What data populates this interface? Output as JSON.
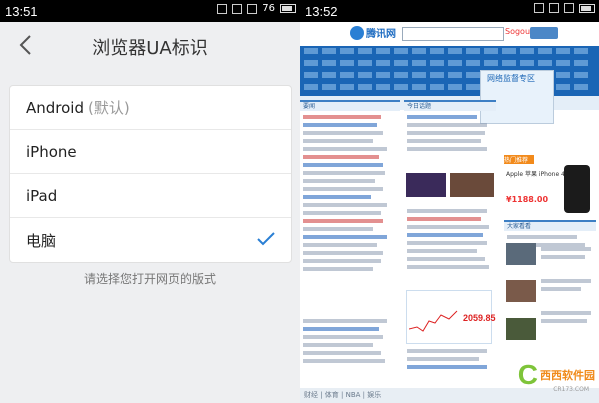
{
  "left": {
    "status": {
      "time": "13:51",
      "battery": "76"
    },
    "nav": {
      "title": "浏览器UA标识"
    },
    "options": [
      {
        "label": "Android",
        "hint": "(默认)",
        "selected": false
      },
      {
        "label": "iPhone",
        "hint": "",
        "selected": false
      },
      {
        "label": "iPad",
        "hint": "",
        "selected": false
      },
      {
        "label": "电脑",
        "hint": "",
        "selected": true
      }
    ],
    "footnote": "请选择您打开网页的版式"
  },
  "right": {
    "status": {
      "time": "13:52"
    },
    "header": {
      "logo": "腾讯网",
      "search_engine": "Sogou"
    },
    "sections": {
      "news": "要闻",
      "today": "今日话题",
      "ad": "网络监督专区",
      "market": "2059.85",
      "phone_ad": "Apple 苹果 iPhone 4S",
      "phone_price": "¥1188.00",
      "phone_hdr": "热门推荐",
      "video": "大家看看"
    },
    "bottom_text": "财经 | 体育 | NBA | 娱乐"
  },
  "watermark": {
    "glyph": "C",
    "text": "西西软件园",
    "sub": "CR173.COM"
  },
  "colors": {
    "accent_blue": "#2a7fd4",
    "check": "#2a7fd4",
    "nav_blue": "#1a65b5"
  }
}
